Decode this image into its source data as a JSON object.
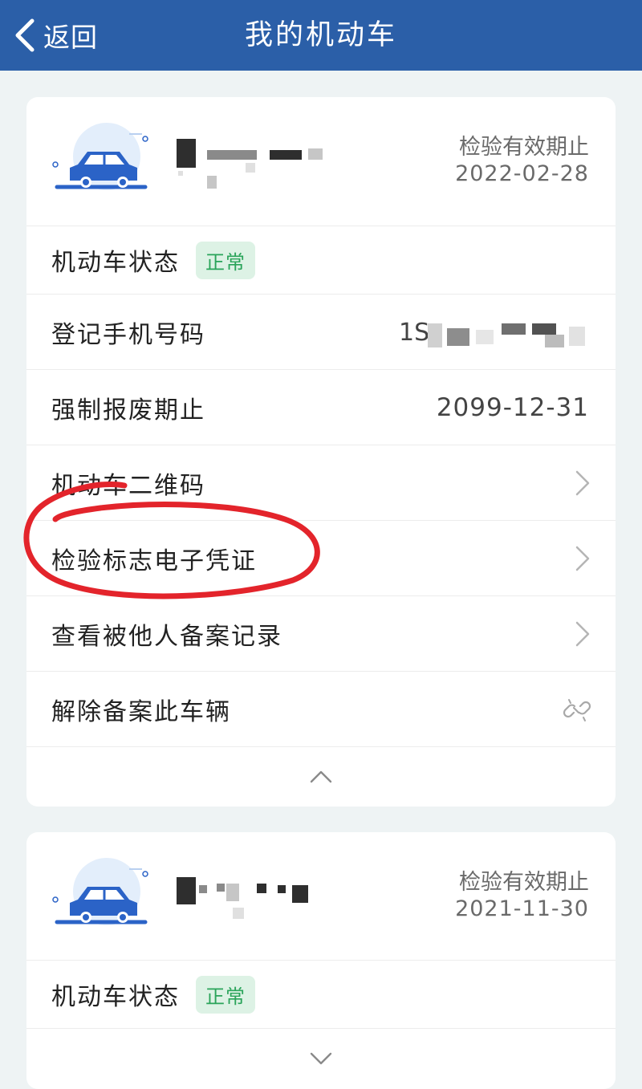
{
  "nav": {
    "back_label": "返回",
    "title": "我的机动车"
  },
  "vehicles": [
    {
      "expiry_label": "检验有效期止",
      "expiry_date": "2022-02-28",
      "status_label": "机动车状态",
      "status_badge": "正常",
      "rows": [
        {
          "label": "登记手机号码",
          "value": "1S"
        },
        {
          "label": "强制报废期止",
          "value": "2099-12-31"
        },
        {
          "label": "机动车二维码",
          "icon": "chevron-right-icon"
        },
        {
          "label": "检验标志电子凭证",
          "icon": "chevron-right-icon"
        },
        {
          "label": "查看被他人备案记录",
          "icon": "chevron-right-icon"
        },
        {
          "label": "解除备案此车辆",
          "icon": "unlink-icon"
        }
      ],
      "toggle_icon": "chevron-up-icon"
    },
    {
      "expiry_label": "检验有效期止",
      "expiry_date": "2021-11-30",
      "status_label": "机动车状态",
      "status_badge": "正常",
      "toggle_icon": "chevron-down-icon"
    }
  ],
  "colors": {
    "nav_bg": "#2b5fa8",
    "badge_bg": "#ddf2e5",
    "badge_text": "#2aa45a",
    "annotation": "#e3242b"
  }
}
